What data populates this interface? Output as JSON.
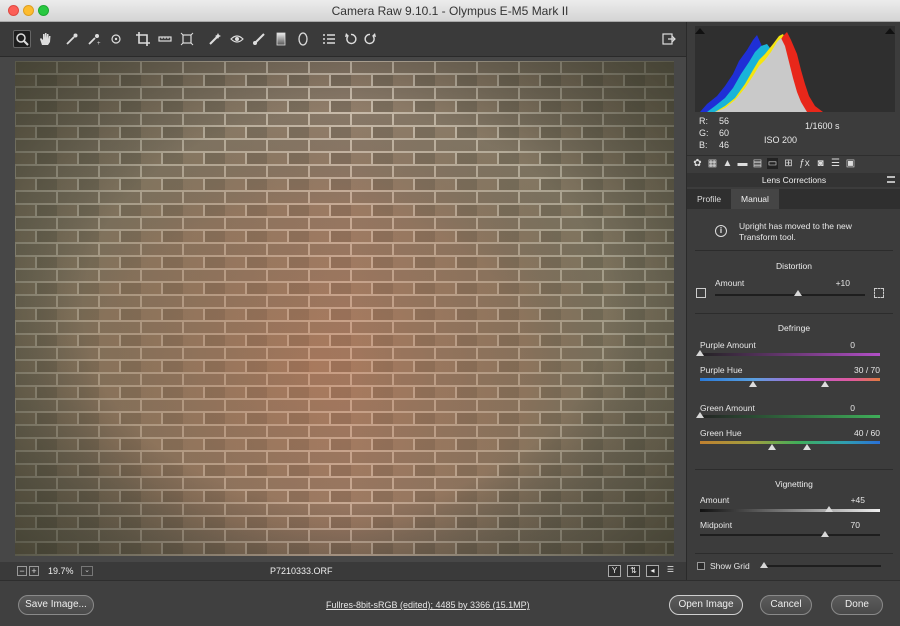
{
  "window": {
    "title": "Camera Raw 9.10.1  -  Olympus E-M5 Mark II"
  },
  "toolbar": {
    "tools": [
      "zoom-icon",
      "hand-icon",
      "white-balance-icon",
      "color-sampler-icon",
      "target-adjustment-icon",
      "crop-icon",
      "straighten-icon",
      "transform-icon",
      "spot-removal-icon",
      "red-eye-icon",
      "adjustment-brush-icon",
      "graduated-filter-icon",
      "radial-filter-icon",
      "presets-list-icon",
      "rotate-left-icon",
      "rotate-right-icon"
    ],
    "fullscreen_icon": "fullscreen-icon"
  },
  "readout": {
    "r_label": "R:",
    "r_value": "56",
    "g_label": "G:",
    "g_value": "60",
    "b_label": "B:",
    "b_value": "46",
    "shutter": "1/1600 s",
    "iso": "ISO 200"
  },
  "panel": {
    "title": "Lens Corrections",
    "tabs": {
      "profile": "Profile",
      "manual": "Manual"
    },
    "notice": "Upright has moved to the new\nTransform tool.",
    "distortion": {
      "title": "Distortion",
      "amount_label": "Amount",
      "amount_value": "+10",
      "amount_pos": 0.55
    },
    "defringe": {
      "title": "Defringe",
      "purple_amount_label": "Purple Amount",
      "purple_amount_value": "0",
      "purple_hue_label": "Purple Hue",
      "purple_hue_value": "30 / 70",
      "green_amount_label": "Green Amount",
      "green_amount_value": "0",
      "green_hue_label": "Green Hue",
      "green_hue_value": "40 / 60"
    },
    "vignetting": {
      "title": "Vignetting",
      "amount_label": "Amount",
      "amount_value": "+45",
      "midpoint_label": "Midpoint",
      "midpoint_value": "70"
    },
    "show_grid_label": "Show Grid"
  },
  "status": {
    "zoom": "19.7%",
    "filename": "P7210333.ORF"
  },
  "bottom": {
    "save": "Save Image...",
    "workflow": "Fullres-8bit-sRGB (edited); 4485 by 3366 (15.1MP)",
    "open": "Open Image",
    "cancel": "Cancel",
    "done": "Done"
  },
  "colors": {
    "accent_purple": "#b24fc7",
    "accent_green": "#3fae5a",
    "hist_red": "#e8271a",
    "hist_yellow": "#f5e510",
    "hist_blue": "#1f2fd6"
  }
}
